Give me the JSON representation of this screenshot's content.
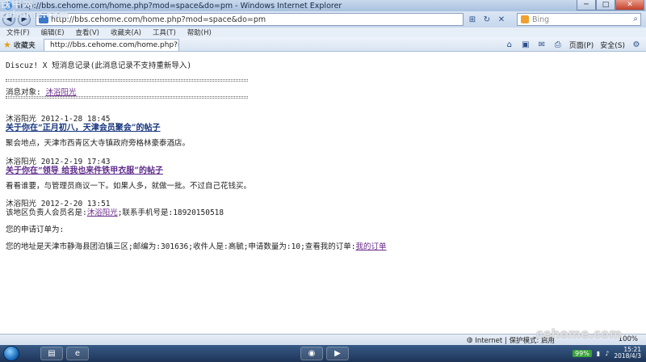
{
  "window": {
    "title": "http://bbs.cehome.com/home.php?mod=space&do=pm - Windows Internet Explorer",
    "controls": [
      "─",
      "□",
      "✕"
    ]
  },
  "addressbar": {
    "url": "http://bbs.cehome.com/home.php?mod=space&do=pm",
    "search_placeholder": "Bing"
  },
  "menubar": {
    "items": [
      "文件(F)",
      "编辑(E)",
      "查看(V)",
      "收藏夹(A)",
      "工具(T)",
      "帮助(H)"
    ]
  },
  "commandbar": {
    "favorites_label": "收藏夹",
    "tab_title": "http://bbs.cehome.com/home.php?mod=sp...",
    "page_menu": "页面(P)",
    "safety_menu": "安全(S)"
  },
  "page": {
    "heading": "Discuz! X 短消息记录(此消息记录不支持重新导入)",
    "separator": "==============================================",
    "target_label": "消息对象:",
    "target_user": "沐浴阳光",
    "messages": [
      {
        "sender_time": "沐浴阳光  2012-1-28 18:45",
        "subject": "关于你在“正月初八，天津会员聚会”的帖子",
        "body": "聚会地点，天津市西青区大寺镇政府旁格林豪泰酒店。"
      },
      {
        "sender_time": "沐浴阳光  2012-2-19 17:43",
        "subject": "关于你在“领导 给我也来件铁甲衣服”的帖子",
        "body": "看看谁要，与管理员商议一下。如果人多，就做一批。不过自己花钱买。"
      },
      {
        "sender_time": "沐浴阳光  2012-2-20 13:51",
        "body_prefix": "该地区负责人会员名是:",
        "body_user": "沐浴阳光",
        "body_suffix": ";联系手机号是:18920150518",
        "order_title": "您的申请订单为:",
        "order_detail": "您的地址是天津市静海县团泊镇三区;邮编为:301636;收件人是:高毓;申请数量为:10;查看我的订单:",
        "order_link": "我的订单"
      }
    ]
  },
  "statusbar": {
    "zone": "Internet | 保护模式: 启用",
    "zoom": "100%"
  },
  "taskbar": {
    "battery": "99%",
    "clock_line1": "15:21",
    "clock_line2": "2018/4/3"
  },
  "watermark": {
    "top_cn": "铁甲网",
    "top_en": "cehome.com",
    "bottom": "cehome.com"
  }
}
